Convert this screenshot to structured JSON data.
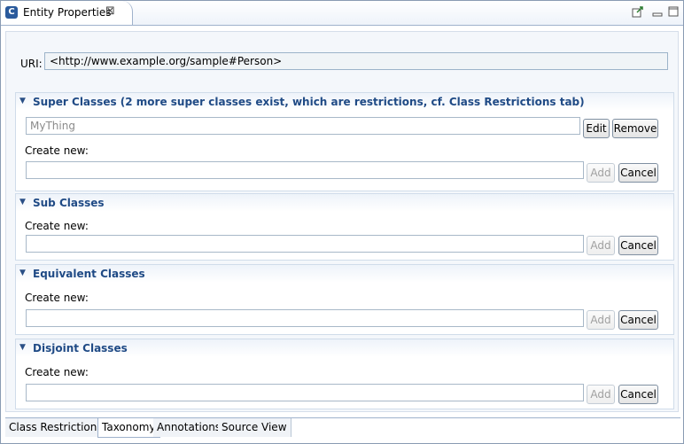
{
  "view": {
    "title": "Entity Properties",
    "icon": "class-icon"
  },
  "toolbar": {
    "pin": "pin-icon",
    "minimize": "minimize-icon",
    "maximize": "maximize-icon"
  },
  "uri": {
    "label": "URI:",
    "value": "<http://www.example.org/sample#Person>"
  },
  "super_classes": {
    "title": "Super Classes (2 more super classes exist, which are restrictions, cf. Class Restrictions tab)",
    "existing": "MyThing",
    "edit_label": "Edit",
    "remove_label": "Remove",
    "create_label": "Create new:",
    "add_label": "Add",
    "cancel_label": "Cancel"
  },
  "sub_classes": {
    "title": "Sub Classes",
    "create_label": "Create new:",
    "add_label": "Add",
    "cancel_label": "Cancel"
  },
  "equivalent_classes": {
    "title": "Equivalent Classes",
    "create_label": "Create new:",
    "add_label": "Add",
    "cancel_label": "Cancel"
  },
  "disjoint_classes": {
    "title": "Disjoint Classes",
    "create_label": "Create new:",
    "add_label": "Add",
    "cancel_label": "Cancel"
  },
  "tabs": [
    {
      "label": "Class Restrictions",
      "active": false
    },
    {
      "label": "Taxonomy",
      "active": true
    },
    {
      "label": "Annotations",
      "active": false
    },
    {
      "label": "Source View",
      "active": false
    }
  ]
}
